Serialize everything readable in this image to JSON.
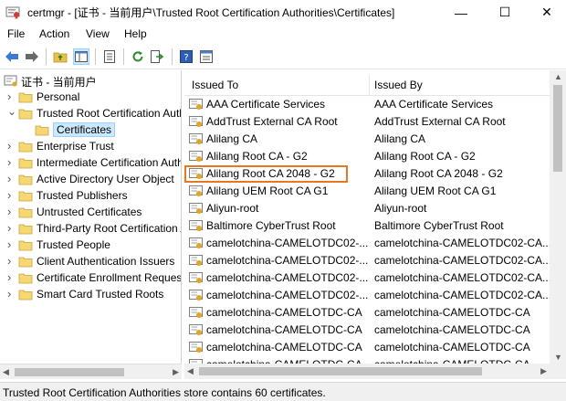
{
  "window": {
    "title": "certmgr - [证书 - 当前用户\\Trusted Root Certification Authorities\\Certificates]",
    "minimize_glyph": "—",
    "maximize_glyph": "☐",
    "close_glyph": "✕"
  },
  "menu": {
    "file": "File",
    "action": "Action",
    "view": "View",
    "help": "Help"
  },
  "toolbar": {
    "icons": [
      "back-icon",
      "forward-icon",
      "up-folder-icon",
      "show-tree-icon",
      "export-list-icon",
      "refresh-icon",
      "export-icon",
      "help-icon",
      "properties-icon"
    ]
  },
  "tree": {
    "root_label": "证书 - 当前用户",
    "items": [
      {
        "label": "Personal",
        "expanded": false
      },
      {
        "label": "Trusted Root Certification Authorities",
        "expanded": true
      },
      {
        "label": "Certificates",
        "selected": true
      },
      {
        "label": "Enterprise Trust",
        "expanded": false
      },
      {
        "label": "Intermediate Certification Authorities",
        "expanded": false
      },
      {
        "label": "Active Directory User Object",
        "expanded": false
      },
      {
        "label": "Trusted Publishers",
        "expanded": false
      },
      {
        "label": "Untrusted Certificates",
        "expanded": false
      },
      {
        "label": "Third-Party Root Certification Authorities",
        "expanded": false
      },
      {
        "label": "Trusted People",
        "expanded": false
      },
      {
        "label": "Client Authentication Issuers",
        "expanded": false
      },
      {
        "label": "Certificate Enrollment Requests",
        "expanded": false
      },
      {
        "label": "Smart Card Trusted Roots",
        "expanded": false
      }
    ]
  },
  "list": {
    "columns": {
      "issued_to": "Issued To",
      "issued_by": "Issued By"
    },
    "rows": [
      {
        "to": "AAA Certificate Services",
        "by": "AAA Certificate Services"
      },
      {
        "to": "AddTrust External CA Root",
        "by": "AddTrust External CA Root"
      },
      {
        "to": "Alilang CA",
        "by": "Alilang CA"
      },
      {
        "to": "Alilang Root CA - G2",
        "by": "Alilang Root CA - G2"
      },
      {
        "to": "Alilang Root CA 2048 - G2",
        "by": "Alilang Root CA 2048 - G2",
        "highlighted": true
      },
      {
        "to": "Alilang UEM Root CA G1",
        "by": "Alilang UEM Root CA G1"
      },
      {
        "to": "Aliyun-root",
        "by": "Aliyun-root"
      },
      {
        "to": "Baltimore CyberTrust Root",
        "by": "Baltimore CyberTrust Root"
      },
      {
        "to": "camelotchina-CAMELOTDC02-...",
        "by": "camelotchina-CAMELOTDC02-CA..."
      },
      {
        "to": "camelotchina-CAMELOTDC02-...",
        "by": "camelotchina-CAMELOTDC02-CA..."
      },
      {
        "to": "camelotchina-CAMELOTDC02-...",
        "by": "camelotchina-CAMELOTDC02-CA..."
      },
      {
        "to": "camelotchina-CAMELOTDC02-...",
        "by": "camelotchina-CAMELOTDC02-CA..."
      },
      {
        "to": "camelotchina-CAMELOTDC-CA",
        "by": "camelotchina-CAMELOTDC-CA"
      },
      {
        "to": "camelotchina-CAMELOTDC-CA",
        "by": "camelotchina-CAMELOTDC-CA"
      },
      {
        "to": "camelotchina-CAMELOTDC-CA",
        "by": "camelotchina-CAMELOTDC-CA"
      },
      {
        "to": "camelotchina-CAMELOTDC-CA",
        "by": "camelotchina-CAMELOTDC-CA"
      }
    ]
  },
  "status": {
    "text": "Trusted Root Certification Authorities store contains 60 certificates."
  },
  "colors": {
    "highlight_border": "#e87722",
    "selection_bg": "#cce8ff",
    "folder_yellow": "#f7d774"
  }
}
